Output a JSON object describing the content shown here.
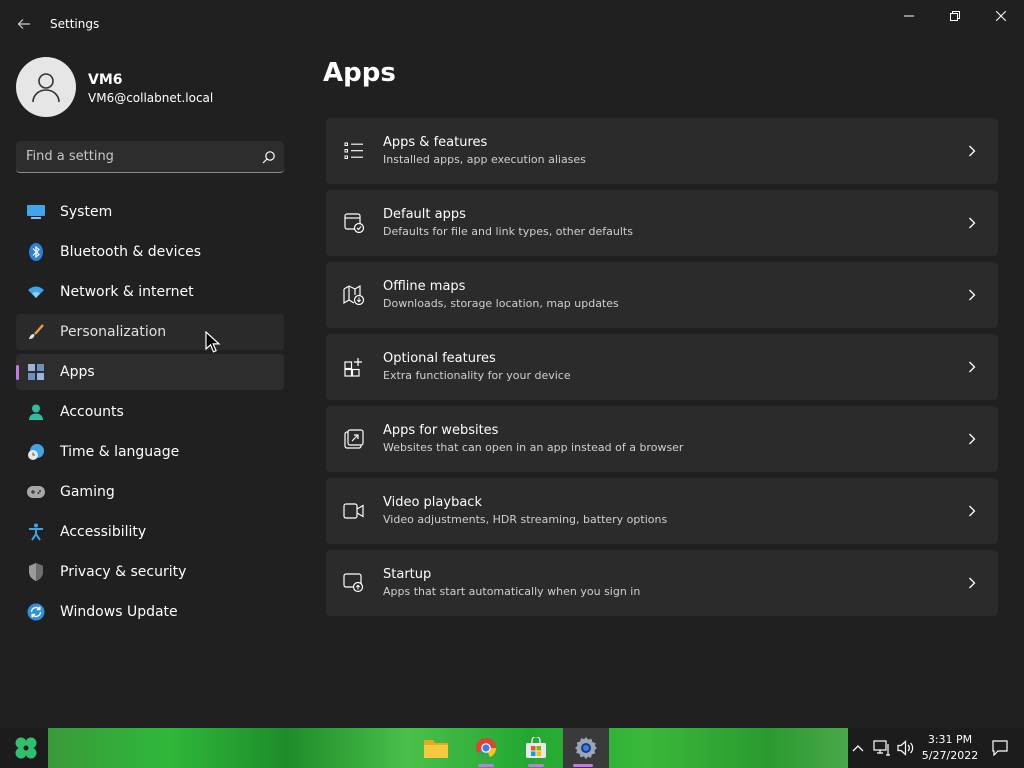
{
  "window": {
    "title": "Settings",
    "controls": {
      "minimize": "minimize-icon",
      "maximize": "restore-icon",
      "close": "close-icon"
    }
  },
  "profile": {
    "name": "VM6",
    "email": "VM6@collabnet.local"
  },
  "search": {
    "placeholder": "Find a setting"
  },
  "nav": {
    "items": [
      {
        "label": "System",
        "icon": "system-icon"
      },
      {
        "label": "Bluetooth & devices",
        "icon": "bluetooth-icon"
      },
      {
        "label": "Network & internet",
        "icon": "wifi-icon"
      },
      {
        "label": "Personalization",
        "icon": "brush-icon",
        "state": "hover"
      },
      {
        "label": "Apps",
        "icon": "apps-icon",
        "state": "active"
      },
      {
        "label": "Accounts",
        "icon": "person-icon"
      },
      {
        "label": "Time & language",
        "icon": "clock-globe-icon"
      },
      {
        "label": "Gaming",
        "icon": "gamepad-icon"
      },
      {
        "label": "Accessibility",
        "icon": "accessibility-icon"
      },
      {
        "label": "Privacy & security",
        "icon": "shield-icon"
      },
      {
        "label": "Windows Update",
        "icon": "update-icon"
      }
    ]
  },
  "main": {
    "title": "Apps",
    "cards": [
      {
        "title": "Apps & features",
        "subtitle": "Installed apps, app execution aliases",
        "icon": "list-icon"
      },
      {
        "title": "Default apps",
        "subtitle": "Defaults for file and link types, other defaults",
        "icon": "default-apps-icon"
      },
      {
        "title": "Offline maps",
        "subtitle": "Downloads, storage location, map updates",
        "icon": "map-download-icon"
      },
      {
        "title": "Optional features",
        "subtitle": "Extra functionality for your device",
        "icon": "add-grid-icon"
      },
      {
        "title": "Apps for websites",
        "subtitle": "Websites that can open in an app instead of a browser",
        "icon": "open-external-icon"
      },
      {
        "title": "Video playback",
        "subtitle": "Video adjustments, HDR streaming, battery options",
        "icon": "video-camera-icon"
      },
      {
        "title": "Startup",
        "subtitle": "Apps that start automatically when you sign in",
        "icon": "startup-icon"
      }
    ]
  },
  "taskbar": {
    "apps": [
      {
        "name": "File Explorer",
        "icon": "folder-icon",
        "state": "normal"
      },
      {
        "name": "Google Chrome",
        "icon": "chrome-icon",
        "state": "running"
      },
      {
        "name": "Microsoft Store",
        "icon": "store-icon",
        "state": "running"
      },
      {
        "name": "Settings",
        "icon": "settings-gear-icon",
        "state": "focused"
      }
    ],
    "clock": {
      "time": "3:31 PM",
      "date": "5/27/2022"
    }
  },
  "colors": {
    "accent": "#c27ae0",
    "background": "#202020",
    "card": "#2b2b2b"
  }
}
